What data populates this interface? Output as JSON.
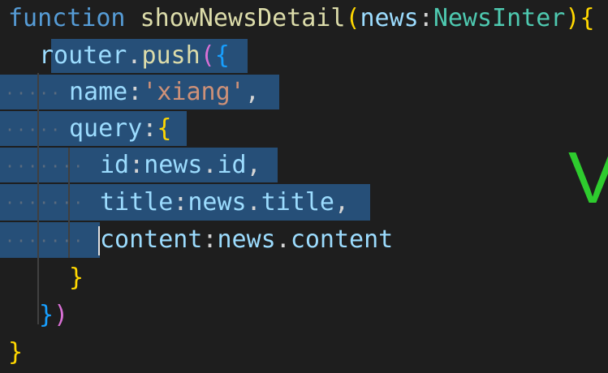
{
  "code": {
    "line1": {
      "keyword": "function",
      "fn_name": "showNewsDetail",
      "open_paren": "(",
      "param": "news",
      "colon": ":",
      "type": "NewsInter",
      "close_paren": ")",
      "open_brace": "{"
    },
    "line2": {
      "obj": "router",
      "dot": ".",
      "method": "push",
      "paren": "(",
      "brace": "{"
    },
    "line3": {
      "key": "name",
      "colon": ":",
      "value": "'xiang'",
      "comma": ","
    },
    "line4": {
      "key": "query",
      "colon": ":",
      "brace": "{"
    },
    "line5": {
      "key": "id",
      "colon": ":",
      "obj": "news",
      "dot": ".",
      "prop": "id",
      "comma": ","
    },
    "line6": {
      "key": "title",
      "colon": ":",
      "obj": "news",
      "dot": ".",
      "prop": "title",
      "comma": ","
    },
    "line7": {
      "key": "content",
      "colon": ":",
      "obj": "news",
      "dot": ".",
      "prop": "content"
    },
    "line8": {
      "brace": "}"
    },
    "line9": {
      "brace": "}",
      "paren": ")"
    },
    "line10": {
      "brace": "}"
    }
  },
  "overlay": {
    "partial_letter": "V"
  },
  "colors": {
    "background": "#1e1e1e",
    "selection": "#264f78",
    "keyword": "#569cd6",
    "function": "#dcdcaa",
    "variable": "#9cdcfe",
    "type": "#4ec9b0",
    "string": "#ce9178",
    "overlay_green": "#2ecc2e"
  }
}
